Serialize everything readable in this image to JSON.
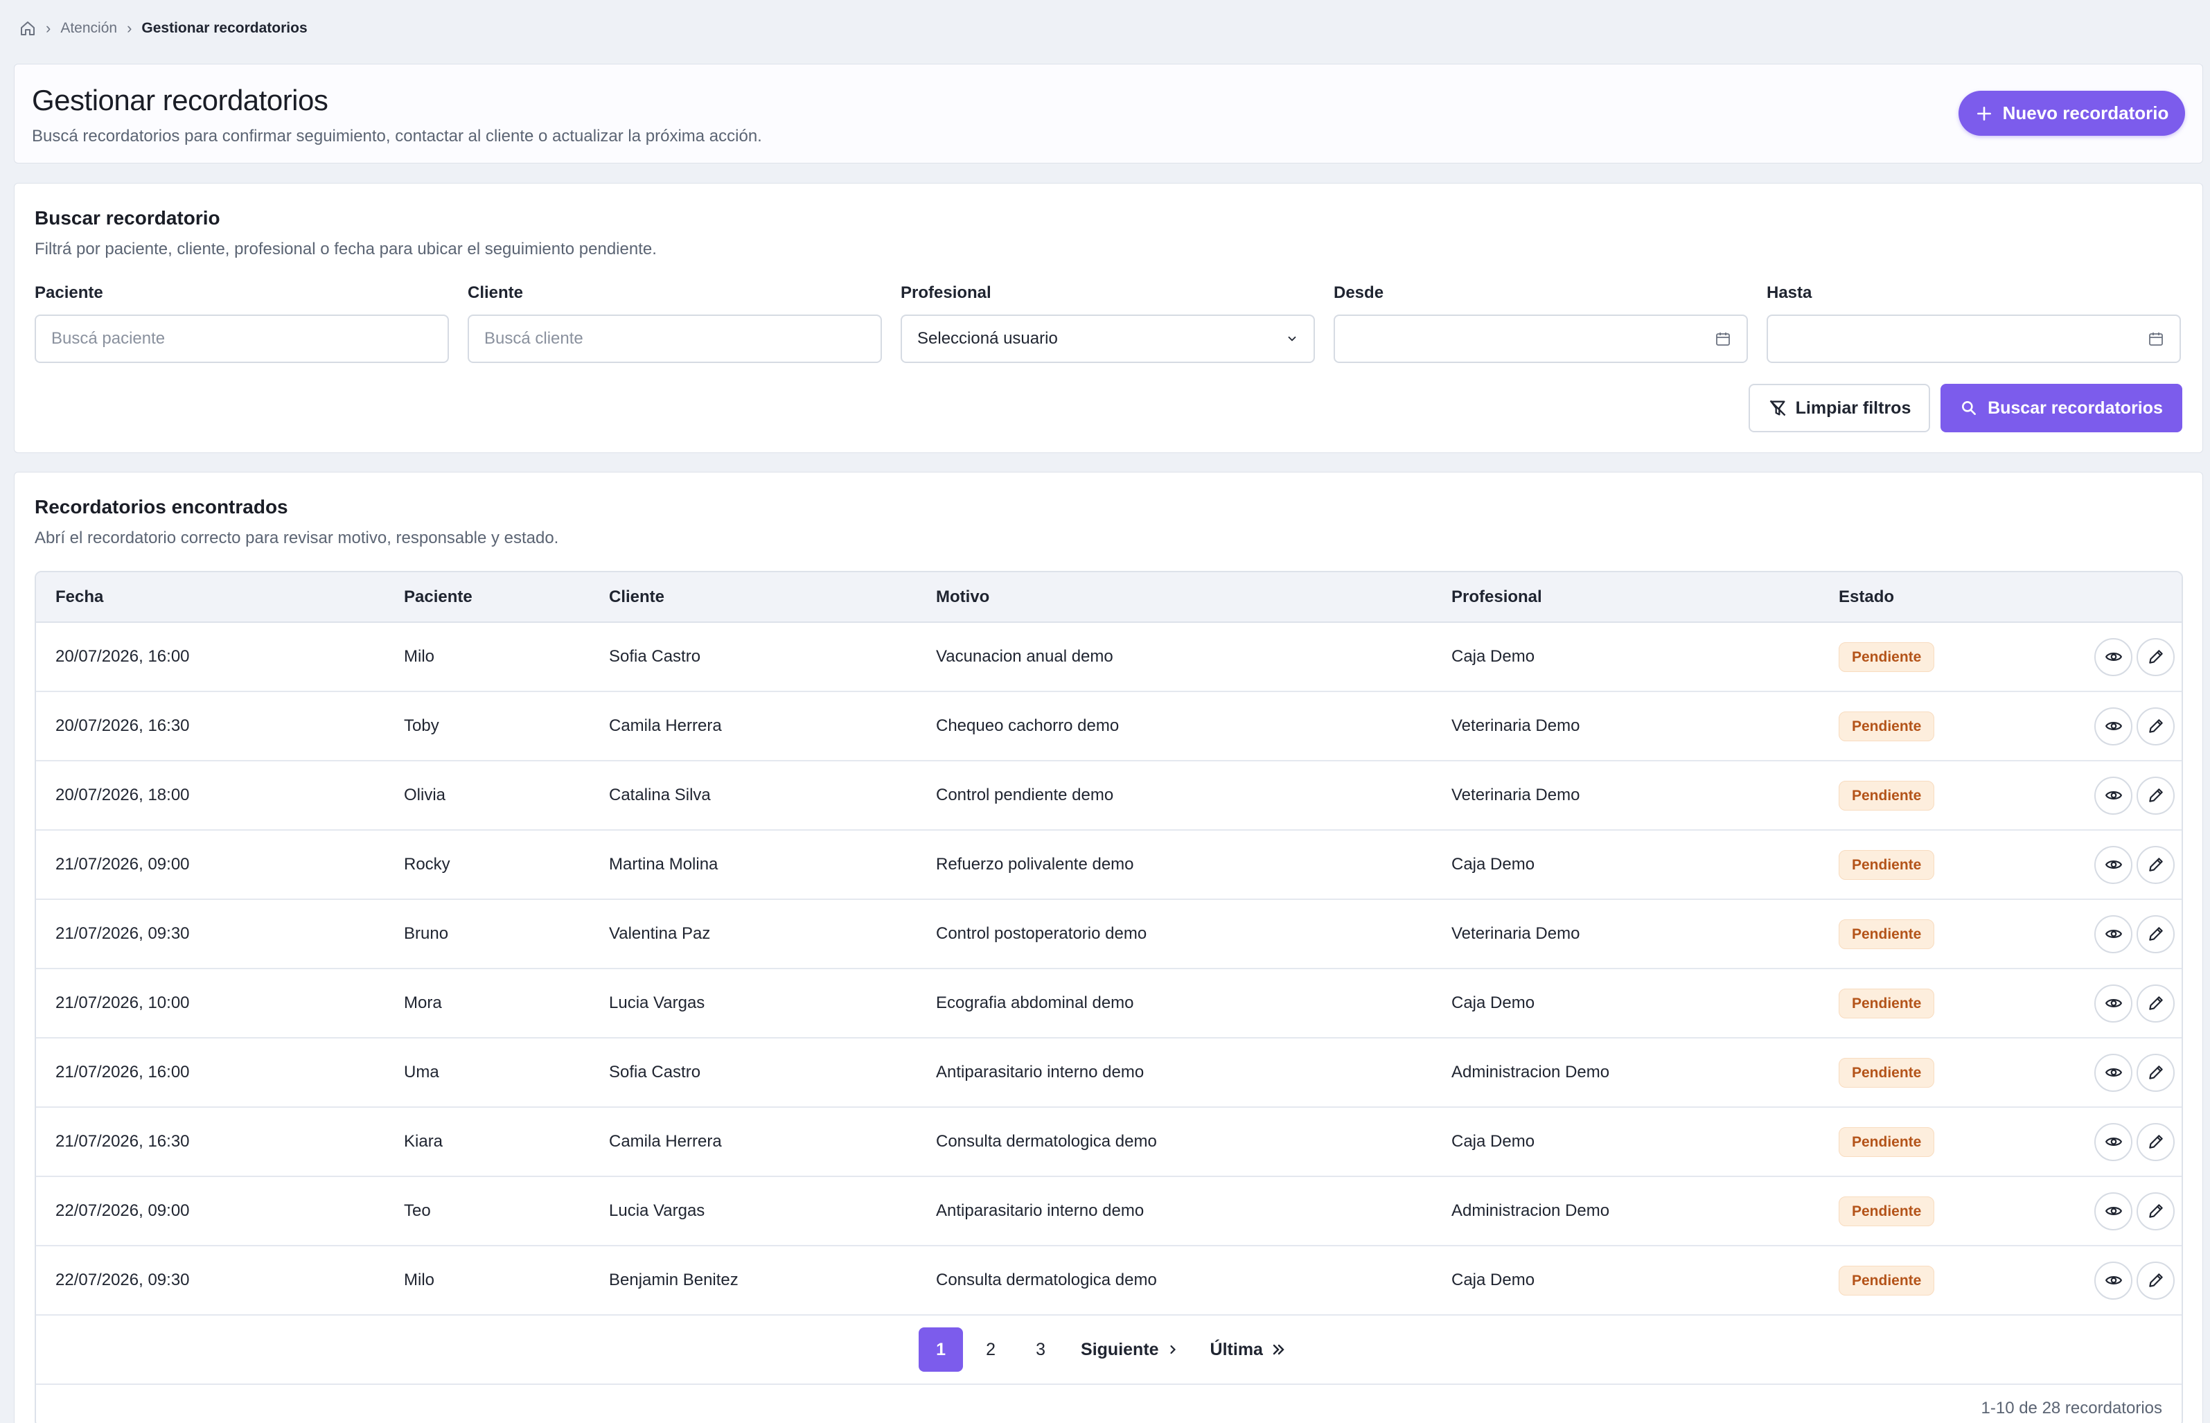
{
  "breadcrumb": {
    "items": [
      "Atención",
      "Gestionar recordatorios"
    ]
  },
  "header": {
    "title": "Gestionar recordatorios",
    "subtitle": "Buscá recordatorios para confirmar seguimiento, contactar al cliente o actualizar la próxima acción.",
    "new_button": "Nuevo recordatorio"
  },
  "search": {
    "title": "Buscar recordatorio",
    "subtitle": "Filtrá por paciente, cliente, profesional o fecha para ubicar el seguimiento pendiente.",
    "fields": {
      "paciente": {
        "label": "Paciente",
        "placeholder": "Buscá paciente",
        "value": ""
      },
      "cliente": {
        "label": "Cliente",
        "placeholder": "Buscá cliente",
        "value": ""
      },
      "profesional": {
        "label": "Profesional",
        "value": "Seleccioná usuario"
      },
      "desde": {
        "label": "Desde",
        "value": ""
      },
      "hasta": {
        "label": "Hasta",
        "value": ""
      }
    },
    "clear_button": "Limpiar filtros",
    "search_button": "Buscar recordatorios"
  },
  "results": {
    "title": "Recordatorios encontrados",
    "subtitle": "Abrí el recordatorio correcto para revisar motivo, responsable y estado.",
    "columns": [
      "Fecha",
      "Paciente",
      "Cliente",
      "Motivo",
      "Profesional",
      "Estado"
    ],
    "rows": [
      {
        "fecha": "20/07/2026, 16:00",
        "paciente": "Milo",
        "cliente": "Sofia Castro",
        "motivo": "Vacunacion anual demo",
        "profesional": "Caja Demo",
        "estado": "Pendiente"
      },
      {
        "fecha": "20/07/2026, 16:30",
        "paciente": "Toby",
        "cliente": "Camila Herrera",
        "motivo": "Chequeo cachorro demo",
        "profesional": "Veterinaria Demo",
        "estado": "Pendiente"
      },
      {
        "fecha": "20/07/2026, 18:00",
        "paciente": "Olivia",
        "cliente": "Catalina Silva",
        "motivo": "Control pendiente demo",
        "profesional": "Veterinaria Demo",
        "estado": "Pendiente"
      },
      {
        "fecha": "21/07/2026, 09:00",
        "paciente": "Rocky",
        "cliente": "Martina Molina",
        "motivo": "Refuerzo polivalente demo",
        "profesional": "Caja Demo",
        "estado": "Pendiente"
      },
      {
        "fecha": "21/07/2026, 09:30",
        "paciente": "Bruno",
        "cliente": "Valentina Paz",
        "motivo": "Control postoperatorio demo",
        "profesional": "Veterinaria Demo",
        "estado": "Pendiente"
      },
      {
        "fecha": "21/07/2026, 10:00",
        "paciente": "Mora",
        "cliente": "Lucia Vargas",
        "motivo": "Ecografia abdominal demo",
        "profesional": "Caja Demo",
        "estado": "Pendiente"
      },
      {
        "fecha": "21/07/2026, 16:00",
        "paciente": "Uma",
        "cliente": "Sofia Castro",
        "motivo": "Antiparasitario interno demo",
        "profesional": "Administracion Demo",
        "estado": "Pendiente"
      },
      {
        "fecha": "21/07/2026, 16:30",
        "paciente": "Kiara",
        "cliente": "Camila Herrera",
        "motivo": "Consulta dermatologica demo",
        "profesional": "Caja Demo",
        "estado": "Pendiente"
      },
      {
        "fecha": "22/07/2026, 09:00",
        "paciente": "Teo",
        "cliente": "Lucia Vargas",
        "motivo": "Antiparasitario interno demo",
        "profesional": "Administracion Demo",
        "estado": "Pendiente"
      },
      {
        "fecha": "22/07/2026, 09:30",
        "paciente": "Milo",
        "cliente": "Benjamin Benitez",
        "motivo": "Consulta dermatologica demo",
        "profesional": "Caja Demo",
        "estado": "Pendiente"
      }
    ],
    "pagination": {
      "pages": [
        "1",
        "2",
        "3"
      ],
      "current": "1",
      "next": "Siguiente",
      "last": "Última"
    },
    "count_text": "1-10 de 28 recordatorios"
  },
  "colors": {
    "accent": "#7c5cec",
    "badge_bg": "#fdeedd",
    "badge_text": "#b4541a",
    "background": "#eef1f6"
  },
  "icons": [
    "home-icon",
    "chevron-right-icon",
    "plus-icon",
    "chevron-down-icon",
    "calendar-icon",
    "filter-off-icon",
    "search-icon",
    "eye-icon",
    "pencil-icon",
    "double-chevron-right-icon"
  ]
}
